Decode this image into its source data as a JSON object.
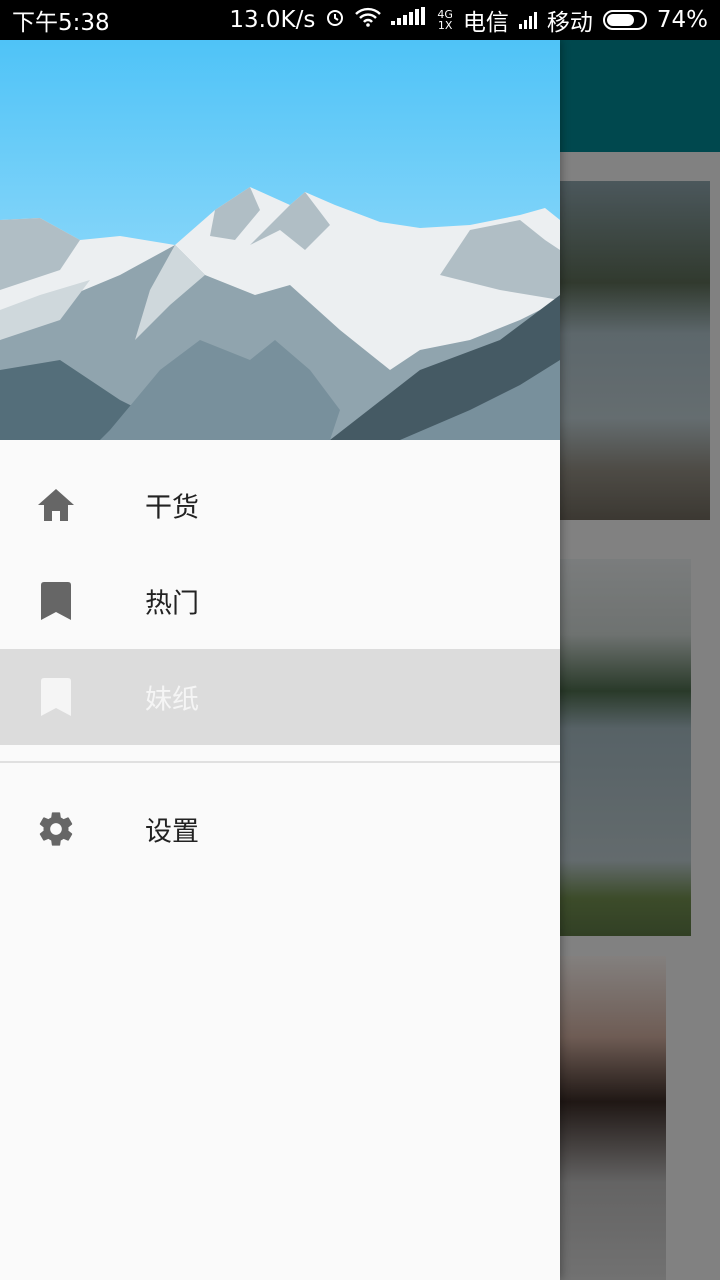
{
  "status_bar": {
    "time": "下午5:38",
    "net_speed": "13.0K/s",
    "network_top": "4G",
    "network_bottom": "1X",
    "carrier1": "电信",
    "carrier2": "移动",
    "battery": "74%",
    "battery_level": 0.74
  },
  "drawer": {
    "items": [
      {
        "label": "干货",
        "icon": "home-icon",
        "active": false
      },
      {
        "label": "热门",
        "icon": "bookmark-icon",
        "active": false
      },
      {
        "label": "妹纸",
        "icon": "bookmark-icon",
        "active": true
      }
    ],
    "footer_items": [
      {
        "label": "设置",
        "icon": "gear-icon"
      }
    ]
  },
  "colors": {
    "toolbar": "#00838f",
    "drawer_bg": "#fafafa",
    "active_bg": "#dcdcdc",
    "icon": "#666666"
  }
}
